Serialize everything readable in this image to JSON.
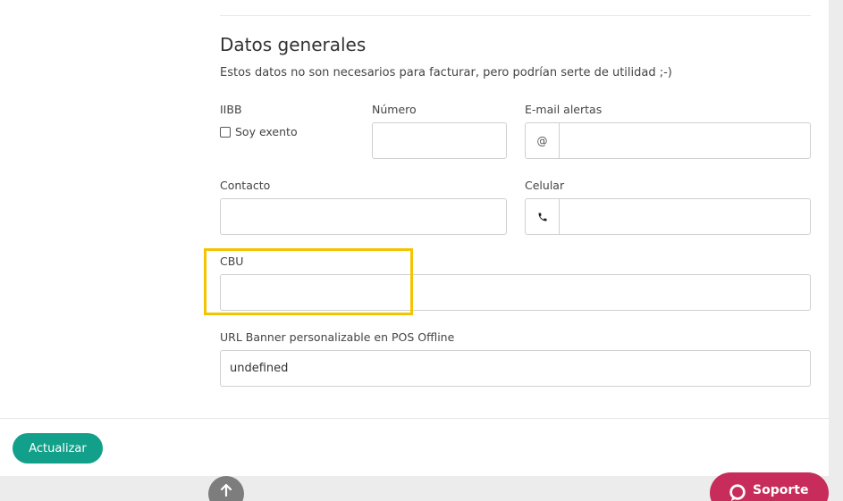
{
  "section": {
    "title": "Datos generales",
    "description": "Estos datos no son necesarios para facturar, pero podrían serte de utilidad ;-)"
  },
  "fields": {
    "iibb": {
      "label": "IIBB",
      "checkbox_label": "Soy exento",
      "checked": false
    },
    "numero": {
      "label": "Número",
      "value": ""
    },
    "email_alertas": {
      "label": "E-mail alertas",
      "addon": "@",
      "value": ""
    },
    "contacto": {
      "label": "Contacto",
      "value": ""
    },
    "celular": {
      "label": "Celular",
      "addon_icon": "phone-icon",
      "value": ""
    },
    "cbu": {
      "label": "CBU",
      "value": ""
    },
    "url_banner": {
      "label": "URL Banner personalizable en POS Offline",
      "value": "undefined"
    }
  },
  "actions": {
    "update_label": "Actualizar",
    "support_label": "Soporte"
  },
  "colors": {
    "primary": "#13a08a",
    "support": "#c72c5a",
    "highlight": "#f5c400",
    "scroll_top": "#7d7d7d"
  }
}
